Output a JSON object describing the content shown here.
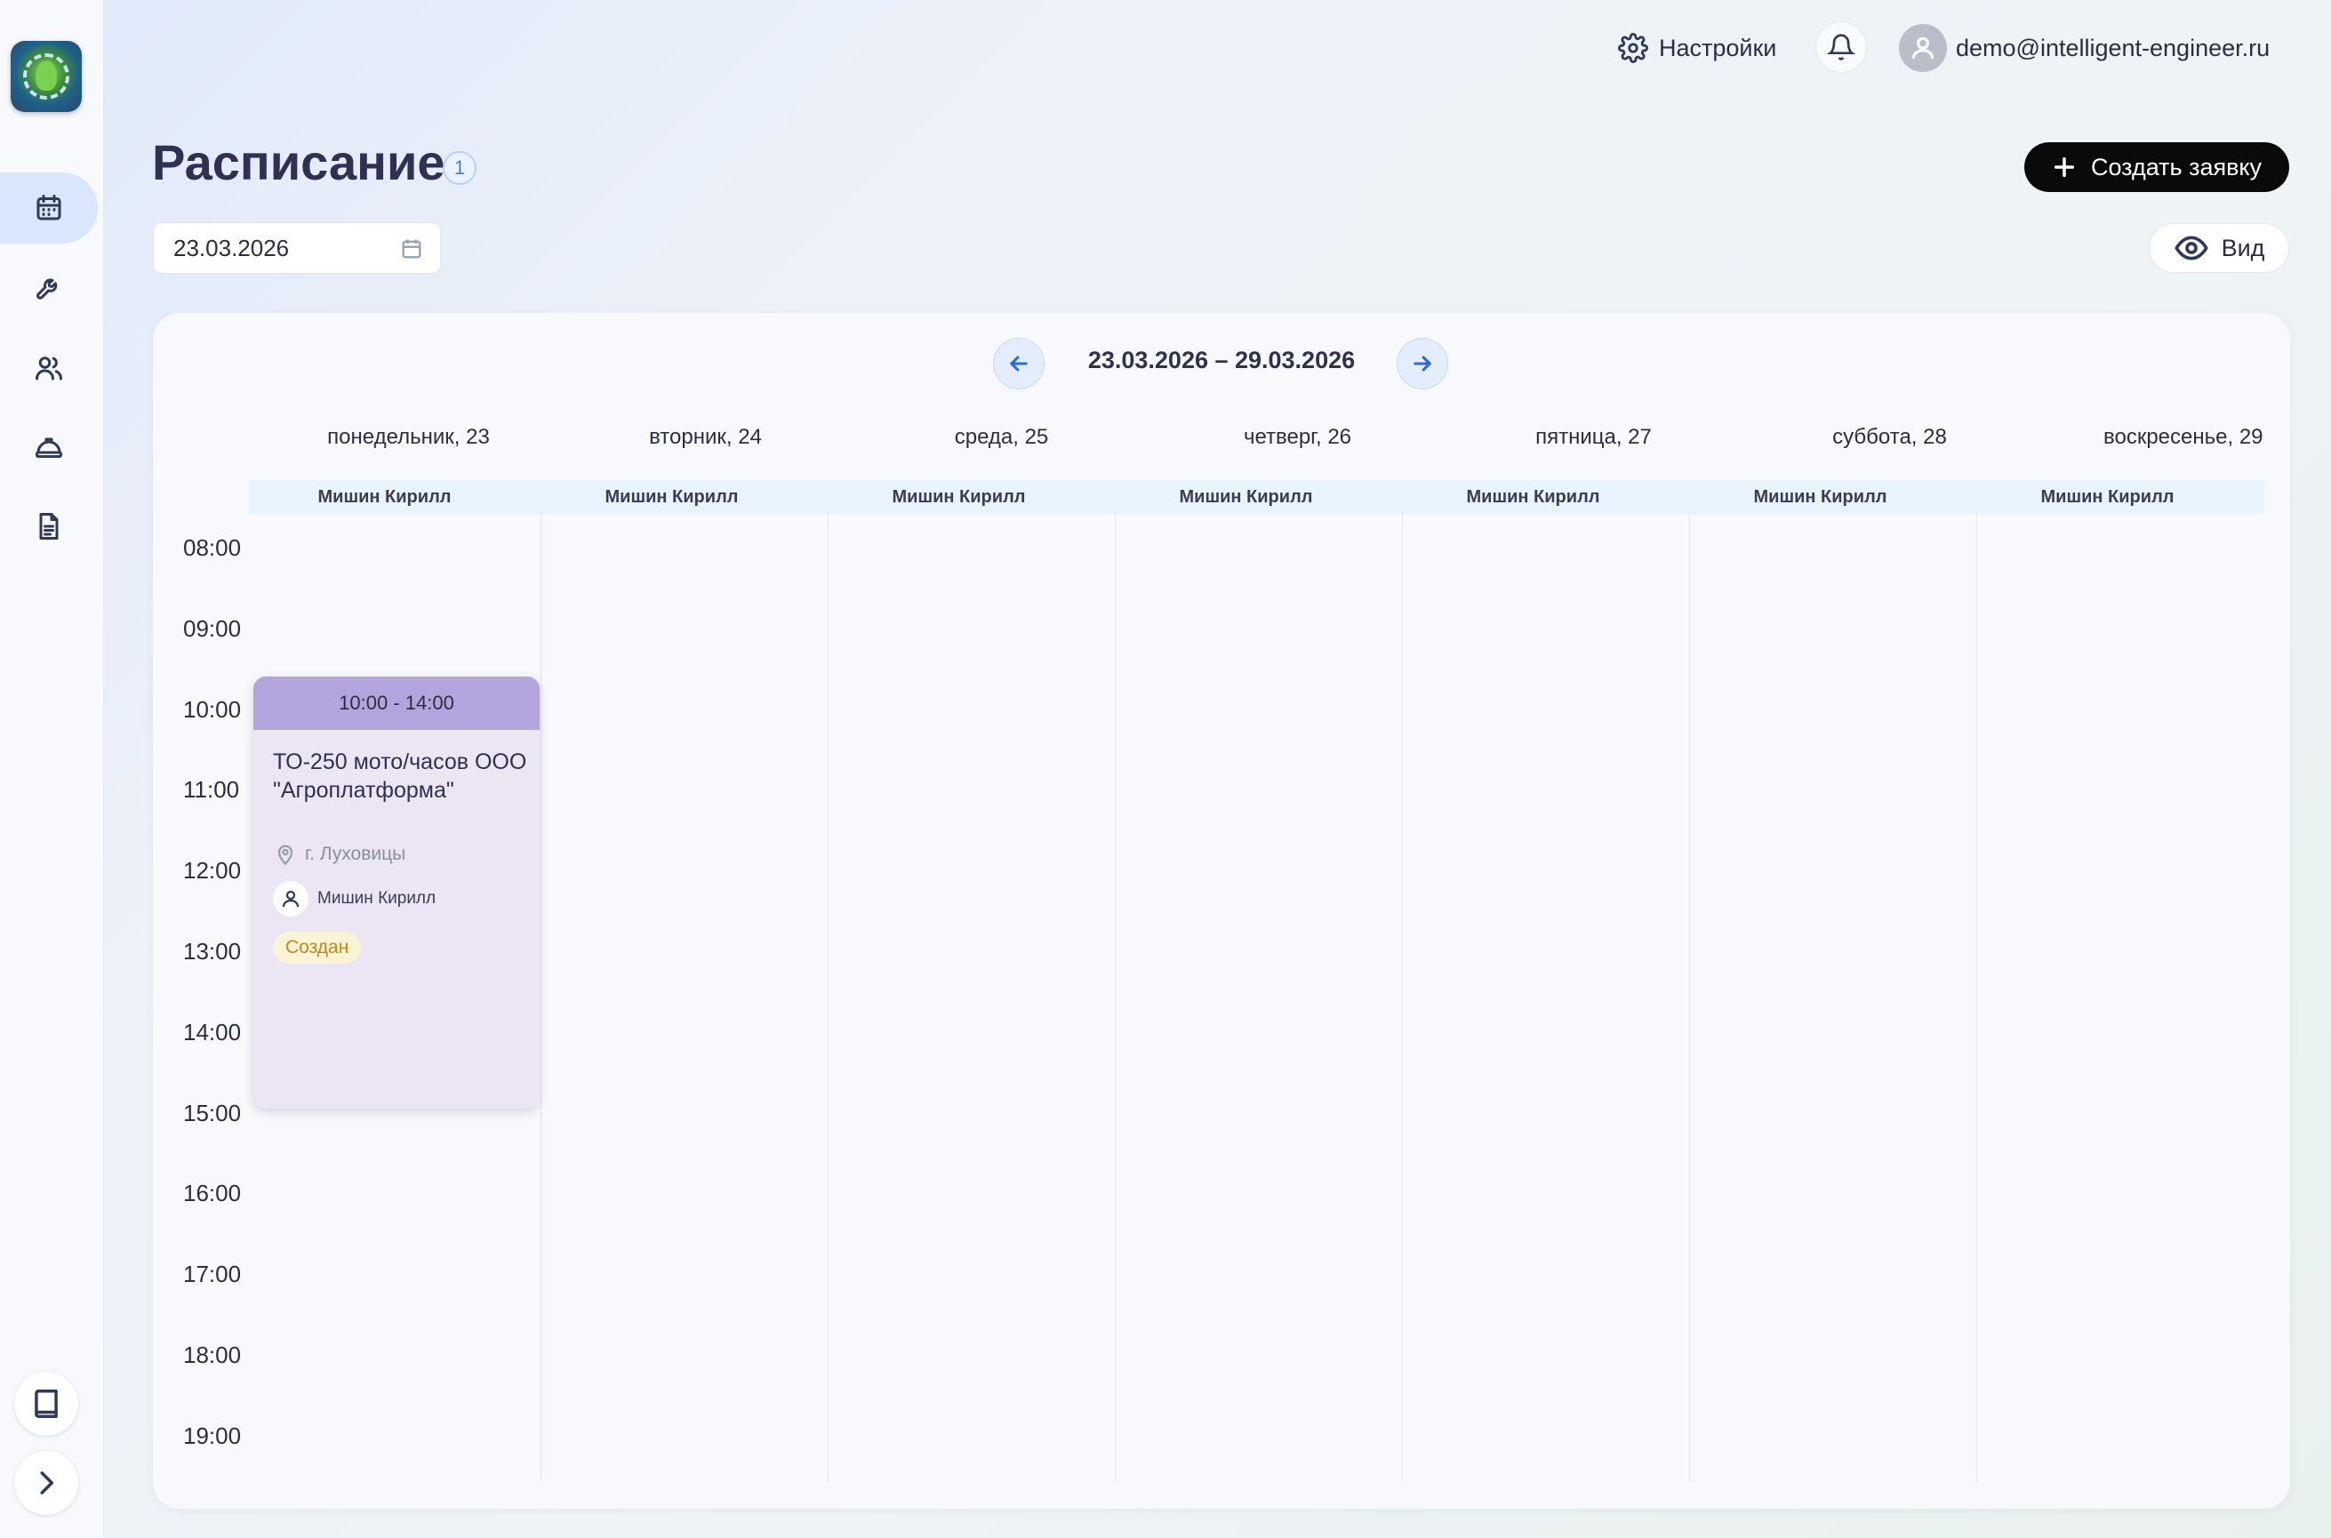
{
  "header": {
    "settings_label": "Настройки",
    "user_email": "demo@intelligent-engineer.ru"
  },
  "page": {
    "title": "Расписание",
    "count_badge": "1",
    "create_button_label": "Создать заявку",
    "date_value": "23.03.2026",
    "view_button_label": "Вид"
  },
  "sidebar": {
    "items": [
      {
        "name": "calendar-icon",
        "active": true
      },
      {
        "name": "wrench-icon",
        "active": false
      },
      {
        "name": "users-icon",
        "active": false
      },
      {
        "name": "hard-hat-icon",
        "active": false
      },
      {
        "name": "document-icon",
        "active": false
      }
    ],
    "bottom": [
      {
        "name": "book-icon"
      },
      {
        "name": "chevron-right-icon"
      }
    ]
  },
  "calendar": {
    "week_range": "23.03.2026 – 29.03.2026",
    "days": [
      {
        "label": "понедельник, 23",
        "resource": "Мишин Кирилл"
      },
      {
        "label": "вторник, 24",
        "resource": "Мишин Кирилл"
      },
      {
        "label": "среда, 25",
        "resource": "Мишин Кирилл"
      },
      {
        "label": "четверг, 26",
        "resource": "Мишин Кирилл"
      },
      {
        "label": "пятница, 27",
        "resource": "Мишин Кирилл"
      },
      {
        "label": "суббота, 28",
        "resource": "Мишин Кирилл"
      },
      {
        "label": "воскресенье, 29",
        "resource": "Мишин Кирилл"
      }
    ],
    "times": [
      "08:00",
      "09:00",
      "10:00",
      "11:00",
      "12:00",
      "13:00",
      "14:00",
      "15:00",
      "16:00",
      "17:00",
      "18:00",
      "19:00"
    ],
    "events": [
      {
        "time": "10:00 - 14:00",
        "title": "ТО-250 мото/часов ООО \"Агроплатформа\"",
        "location": "г. Луховицы",
        "person": "Мишин Кирилл",
        "status": "Создан",
        "status_color": "#c08a1b"
      }
    ]
  },
  "colors": {
    "accent": "#2f6ad6",
    "event_header": "#b4a4dd",
    "event_body": "#ebe5f4",
    "primary_button": "#0a0a0a"
  }
}
